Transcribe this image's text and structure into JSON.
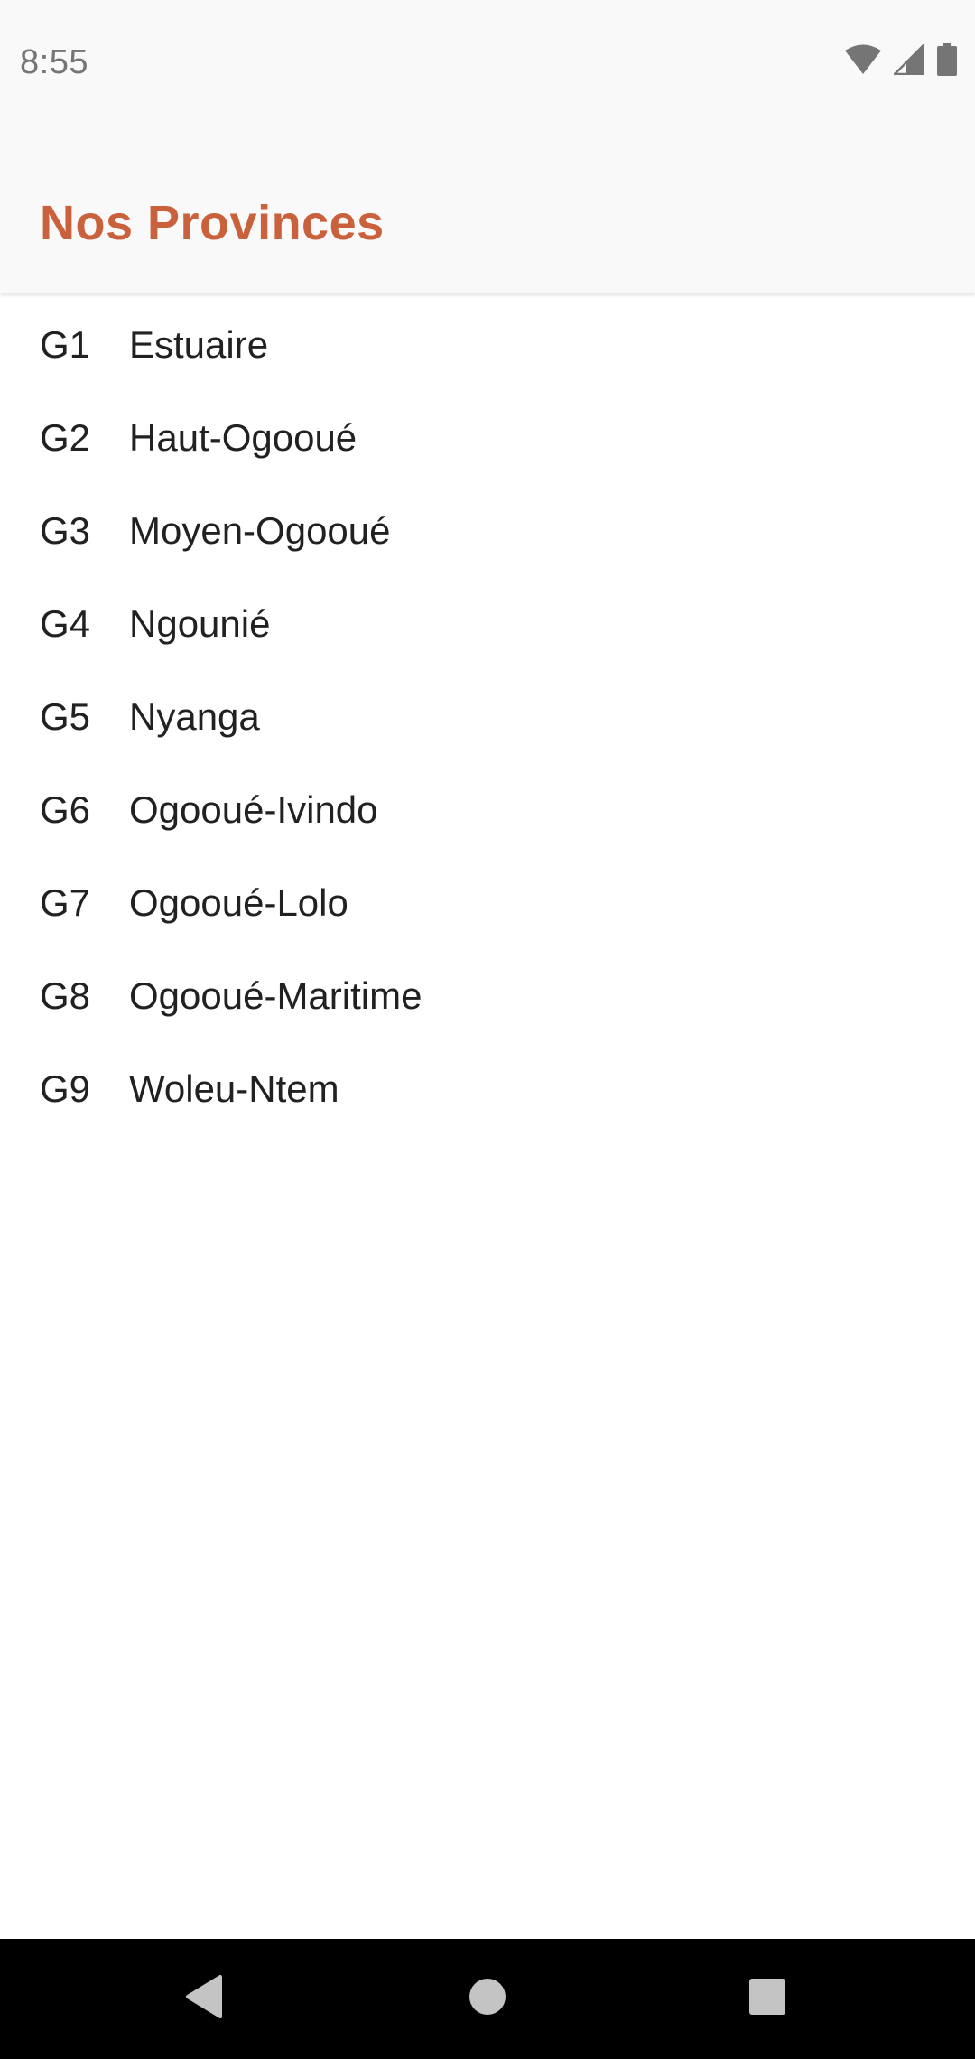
{
  "status_bar": {
    "time": "8:55",
    "icons": [
      "wifi-icon",
      "cell-signal-icon",
      "battery-icon"
    ]
  },
  "app_bar": {
    "title": "Nos Provinces",
    "title_color": "#c9613d"
  },
  "provinces": [
    {
      "code": "G1",
      "name": "Estuaire"
    },
    {
      "code": "G2",
      "name": "Haut-Ogooué"
    },
    {
      "code": "G3",
      "name": "Moyen-Ogooué"
    },
    {
      "code": "G4",
      "name": "Ngounié"
    },
    {
      "code": "G5",
      "name": "Nyanga"
    },
    {
      "code": "G6",
      "name": "Ogooué-Ivindo"
    },
    {
      "code": "G7",
      "name": "Ogooué-Lolo"
    },
    {
      "code": "G8",
      "name": "Ogooué-Maritime"
    },
    {
      "code": "G9",
      "name": "Woleu-Ntem"
    }
  ],
  "nav_bar": {
    "buttons": [
      "back-icon",
      "home-icon",
      "recents-icon"
    ]
  }
}
